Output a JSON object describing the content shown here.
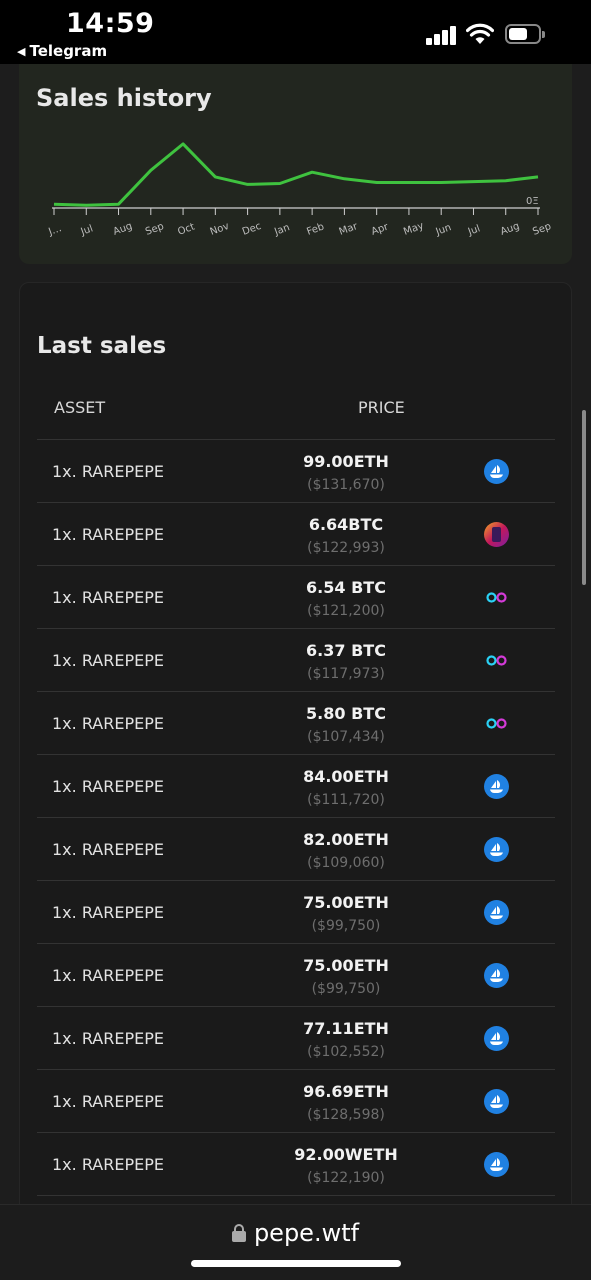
{
  "status_bar": {
    "time": "14:59",
    "back_label": "Telegram"
  },
  "history": {
    "title": "Sales history",
    "y_tick": "0Ξ",
    "x_ticks": [
      "J…",
      "Jul",
      "Aug",
      "Sep",
      "Oct",
      "Nov",
      "Dec",
      "Jan",
      "Feb",
      "Mar",
      "Apr",
      "May",
      "Jun",
      "Jul",
      "Aug",
      "Sep"
    ],
    "line_color": "#3fc23f"
  },
  "chart_data": {
    "type": "line",
    "title": "Sales history",
    "categories": [
      "J…",
      "Jul",
      "Aug",
      "Sep",
      "Oct",
      "Nov",
      "Dec",
      "Jan",
      "Feb",
      "Mar",
      "Apr",
      "May",
      "Jun",
      "Jul",
      "Aug",
      "Sep"
    ],
    "ytick": "0Ξ",
    "series": [
      {
        "values": [
          4,
          3,
          4,
          40,
          68,
          33,
          25,
          26,
          38,
          31,
          27,
          27,
          27,
          28,
          29,
          33
        ]
      }
    ],
    "grid": false
  },
  "sales": {
    "title": "Last sales",
    "col_asset": "ASSET",
    "col_price": "PRICE",
    "rows": [
      {
        "asset": "1x. RAREPEPE",
        "price": "99.00ETH",
        "usd": "($131,670)",
        "market": "opensea-icon"
      },
      {
        "asset": "1x. RAREPEPE",
        "price": "6.64BTC",
        "usd": "($122,993)",
        "market": "magiceden-icon"
      },
      {
        "asset": "1x. RAREPEPE",
        "price": "6.54 BTC",
        "usd": "($121,200)",
        "market": "infinity-icon"
      },
      {
        "asset": "1x. RAREPEPE",
        "price": "6.37 BTC",
        "usd": "($117,973)",
        "market": "infinity-icon"
      },
      {
        "asset": "1x. RAREPEPE",
        "price": "5.80 BTC",
        "usd": "($107,434)",
        "market": "infinity-icon"
      },
      {
        "asset": "1x. RAREPEPE",
        "price": "84.00ETH",
        "usd": "($111,720)",
        "market": "opensea-icon"
      },
      {
        "asset": "1x. RAREPEPE",
        "price": "82.00ETH",
        "usd": "($109,060)",
        "market": "opensea-icon"
      },
      {
        "asset": "1x. RAREPEPE",
        "price": "75.00ETH",
        "usd": "($99,750)",
        "market": "opensea-icon"
      },
      {
        "asset": "1x. RAREPEPE",
        "price": "75.00ETH",
        "usd": "($99,750)",
        "market": "opensea-icon"
      },
      {
        "asset": "1x. RAREPEPE",
        "price": "77.11ETH",
        "usd": "($102,552)",
        "market": "opensea-icon"
      },
      {
        "asset": "1x. RAREPEPE",
        "price": "96.69ETH",
        "usd": "($128,598)",
        "market": "opensea-icon"
      },
      {
        "asset": "1x. RAREPEPE",
        "price": "92.00WETH",
        "usd": "($122,190)",
        "market": "opensea-icon"
      }
    ]
  },
  "url_bar": {
    "url": "pepe.wtf"
  }
}
